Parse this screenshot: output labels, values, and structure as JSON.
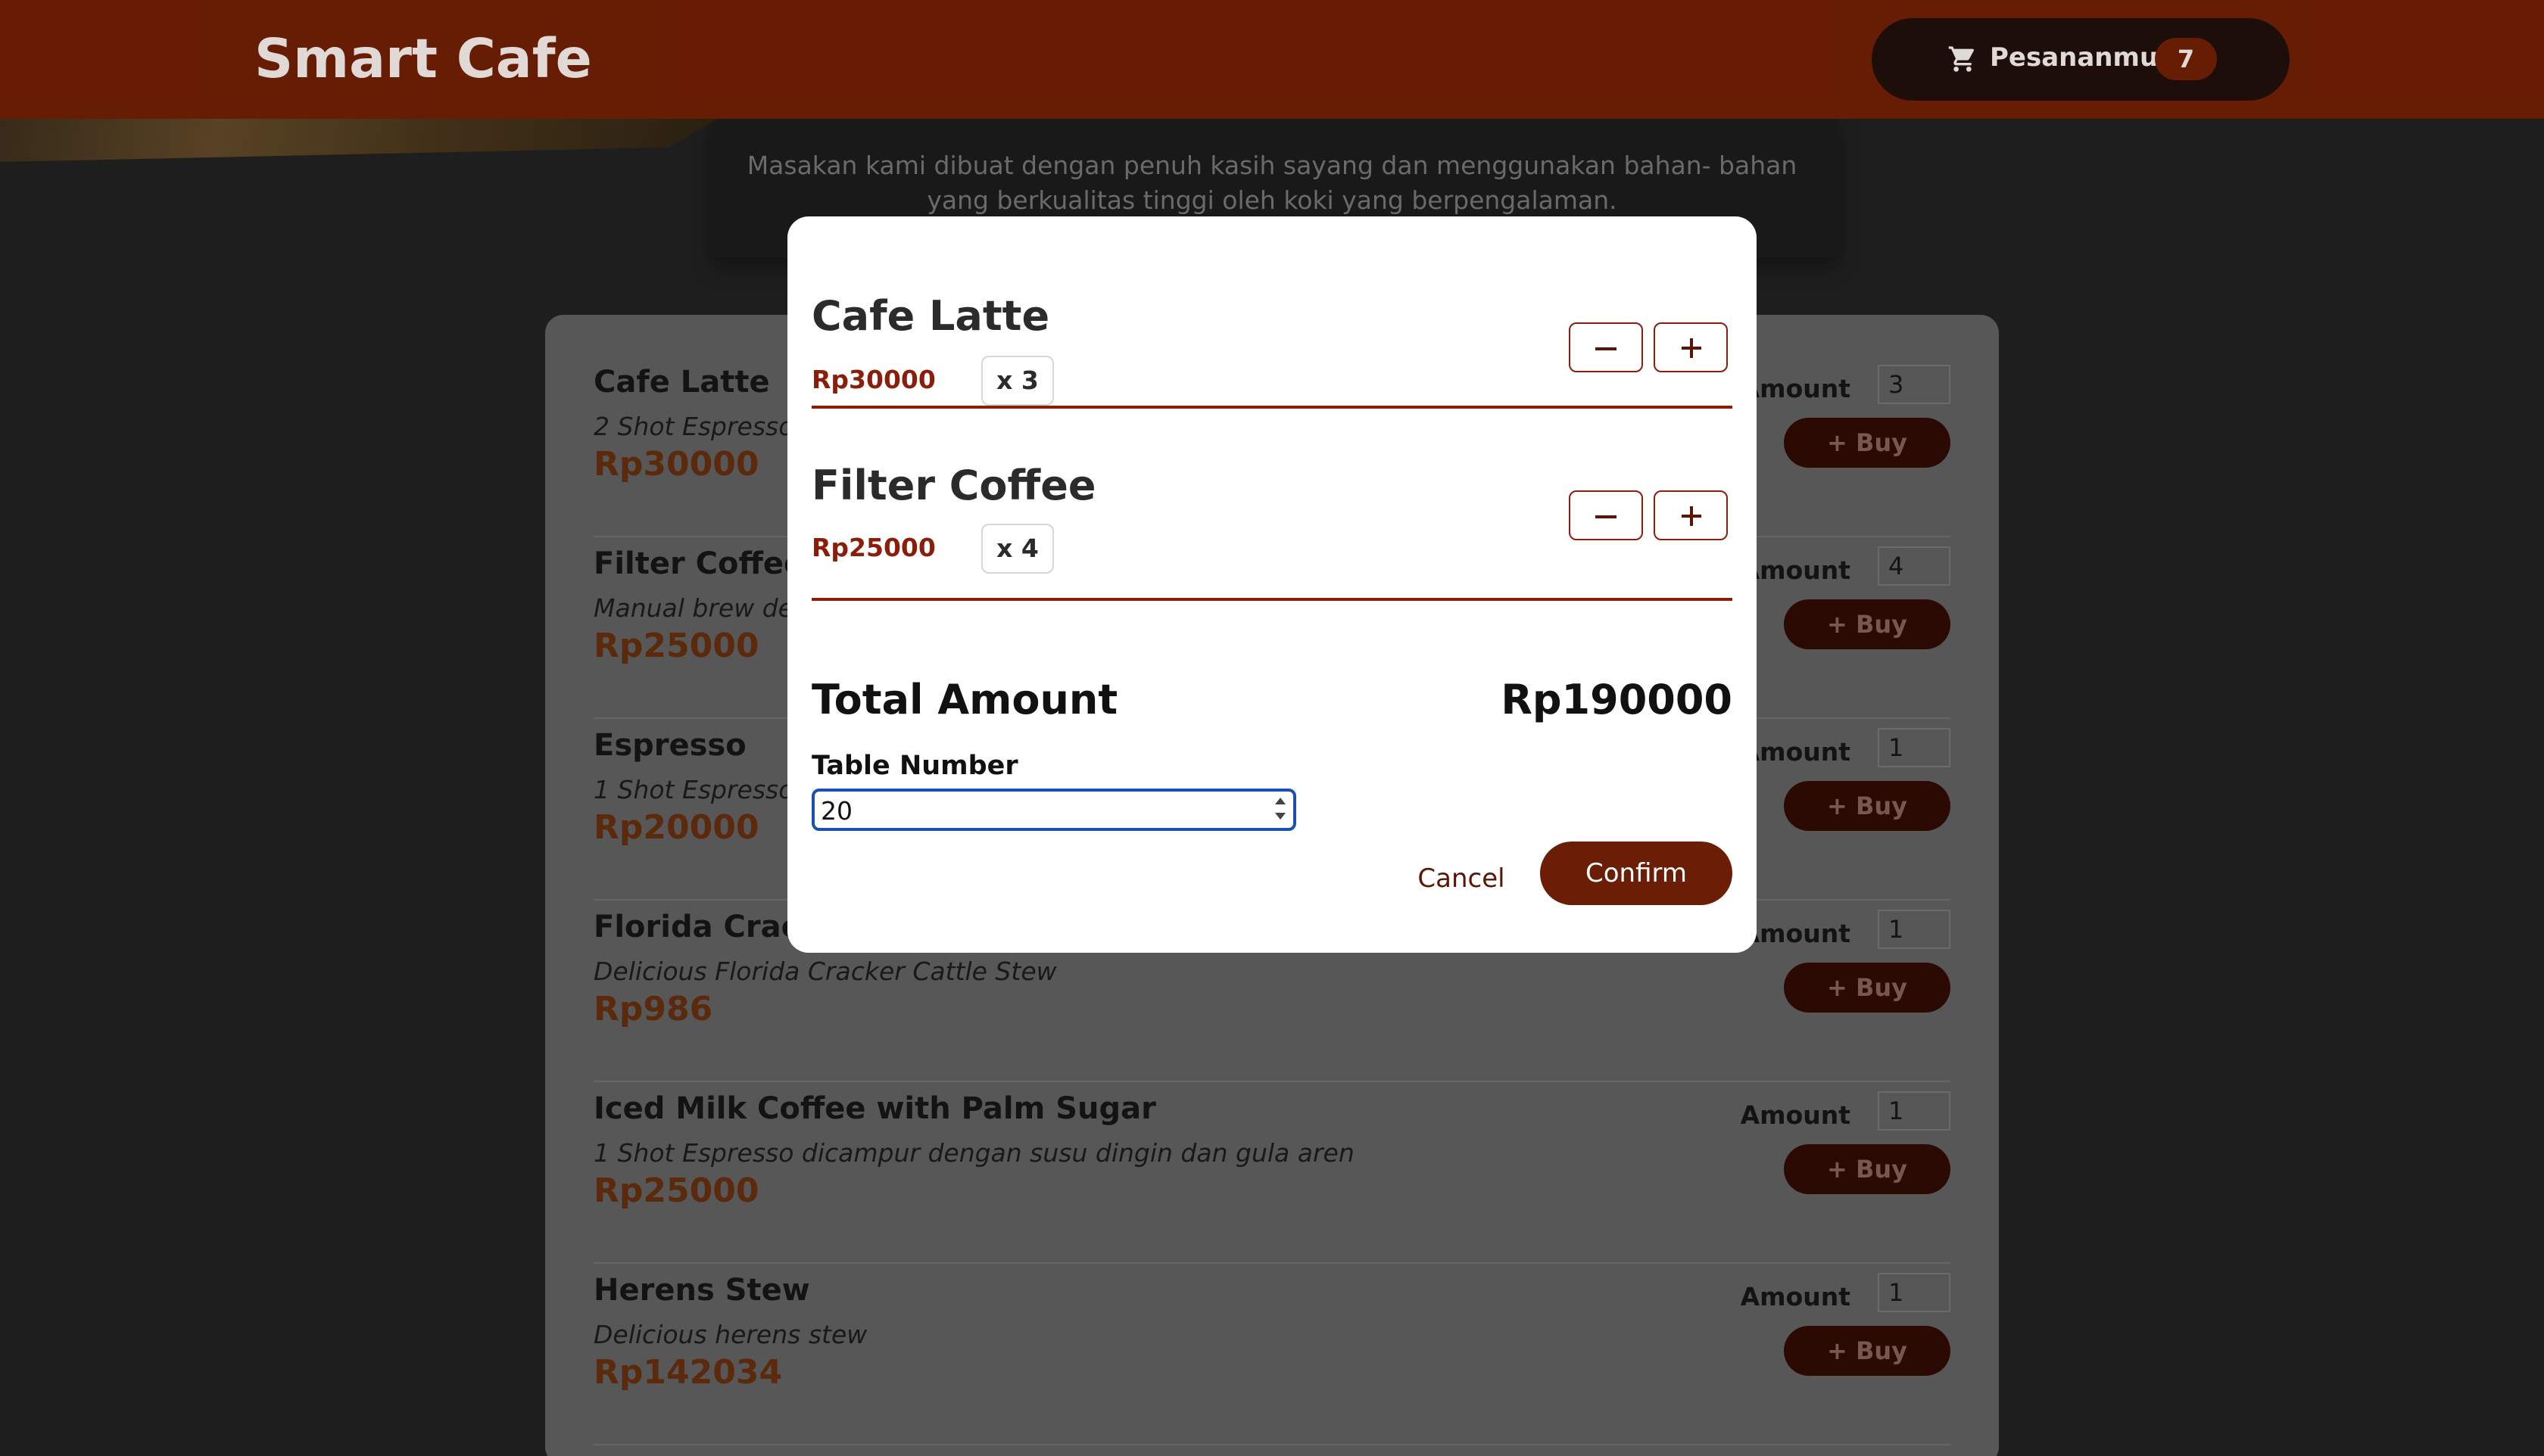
{
  "header": {
    "brand": "Smart Cafe",
    "cart_label": "Pesananmu",
    "cart_count": "7",
    "cart_icon": "shopping-cart-icon"
  },
  "about": {
    "text": "Masakan kami dibuat dengan penuh kasih sayang dan menggunakan bahan- bahan yang berkualitas tinggi oleh koki yang berpengalaman."
  },
  "menu": {
    "amount_label": "Amount",
    "buy_label": "+ Buy",
    "items": [
      {
        "name": "Cafe Latte",
        "desc": "2 Shot Espresso d",
        "price": "Rp30000",
        "amount": "3"
      },
      {
        "name": "Filter Coffee",
        "desc": "Manual brew den",
        "price": "Rp25000",
        "amount": "4"
      },
      {
        "name": "Espresso",
        "desc": "1 Shot Espresso",
        "price": "Rp20000",
        "amount": "1"
      },
      {
        "name": "Florida Cracke",
        "desc": "Delicious Florida Cracker Cattle Stew",
        "price": "Rp986",
        "amount": "1"
      },
      {
        "name": "Iced Milk Coffee with Palm Sugar",
        "desc": "1 Shot Espresso dicampur dengan susu dingin dan gula aren",
        "price": "Rp25000",
        "amount": "1"
      },
      {
        "name": "Herens Stew",
        "desc": "Delicious herens stew",
        "price": "Rp142034",
        "amount": "1"
      }
    ]
  },
  "modal": {
    "cart_items": [
      {
        "name": "Cafe Latte",
        "price": "Rp30000",
        "qty": "x 3"
      },
      {
        "name": "Filter Coffee",
        "price": "Rp25000",
        "qty": "x 4"
      }
    ],
    "total_label": "Total Amount",
    "total_value": "Rp190000",
    "table_label": "Table Number",
    "table_value": "20",
    "cancel_label": "Cancel",
    "confirm_label": "Confirm"
  },
  "colors": {
    "brand": "#6b1d05",
    "accent_price": "#8a1e0a",
    "focus": "#1a4fb3"
  }
}
